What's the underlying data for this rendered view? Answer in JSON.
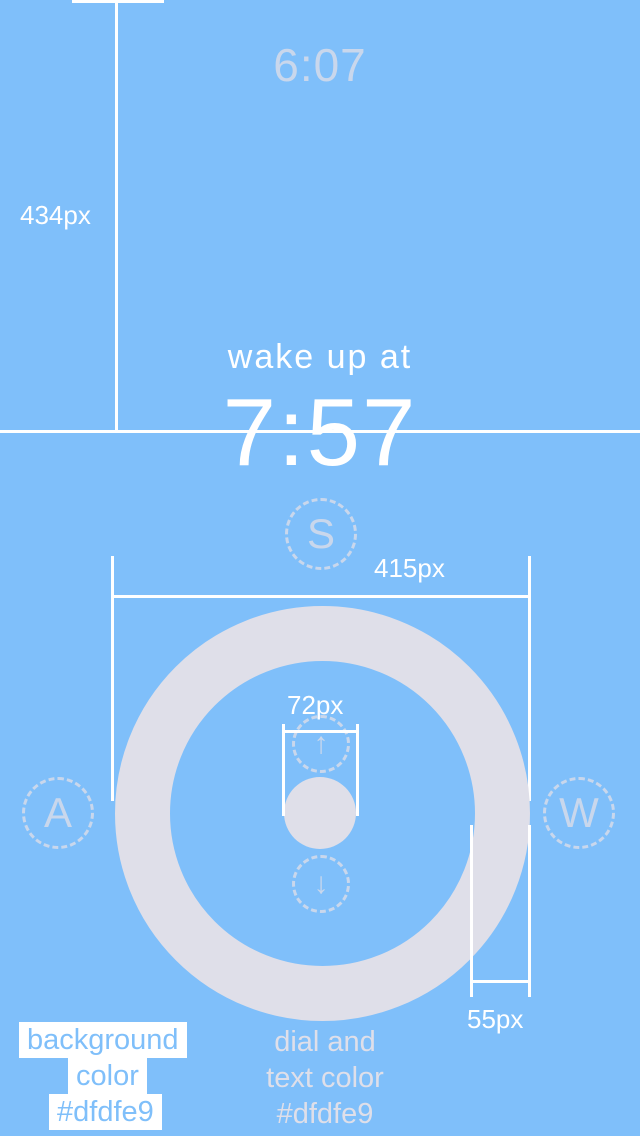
{
  "clock": {
    "current_time": "6:07"
  },
  "wake": {
    "label": "wake up at",
    "time": "7:57"
  },
  "modes": {
    "s": "S",
    "a": "A",
    "w": "W"
  },
  "controls": {
    "up_icon": "arrow-up-icon",
    "down_icon": "arrow-down-icon"
  },
  "annotations": {
    "height_434": "434px",
    "width_415": "415px",
    "knob_72": "72px",
    "ring_55": "55px",
    "background_note": [
      "background",
      "color",
      "#dfdfe9"
    ],
    "dial_note": [
      "dial and",
      "text color",
      "#dfdfe9"
    ]
  },
  "colors": {
    "background": "#7fbffa",
    "dial": "#dfdfe9",
    "dimmed": "#c9d7ec",
    "annotation": "#ffffff"
  }
}
